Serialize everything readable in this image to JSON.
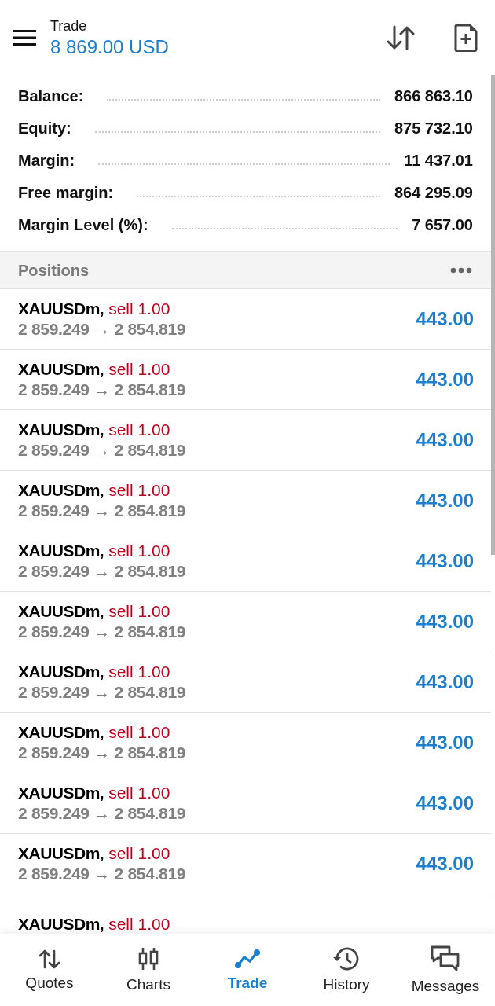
{
  "header": {
    "title": "Trade",
    "balance": "8 869.00 USD"
  },
  "summary": [
    {
      "label": "Balance:",
      "value": "866 863.10"
    },
    {
      "label": "Equity:",
      "value": "875 732.10"
    },
    {
      "label": "Margin:",
      "value": "11 437.01"
    },
    {
      "label": "Free margin:",
      "value": "864 295.09"
    },
    {
      "label": "Margin Level (%):",
      "value": "7 657.00"
    }
  ],
  "positions_header": {
    "title": "Positions"
  },
  "positions": [
    {
      "symbol": "XAUUSDm,",
      "side": "sell 1.00",
      "prices": "2 859.249 → 2 854.819",
      "profit": "443.00"
    },
    {
      "symbol": "XAUUSDm,",
      "side": "sell 1.00",
      "prices": "2 859.249 → 2 854.819",
      "profit": "443.00"
    },
    {
      "symbol": "XAUUSDm,",
      "side": "sell 1.00",
      "prices": "2 859.249 → 2 854.819",
      "profit": "443.00"
    },
    {
      "symbol": "XAUUSDm,",
      "side": "sell 1.00",
      "prices": "2 859.249 → 2 854.819",
      "profit": "443.00"
    },
    {
      "symbol": "XAUUSDm,",
      "side": "sell 1.00",
      "prices": "2 859.249 → 2 854.819",
      "profit": "443.00"
    },
    {
      "symbol": "XAUUSDm,",
      "side": "sell 1.00",
      "prices": "2 859.249 → 2 854.819",
      "profit": "443.00"
    },
    {
      "symbol": "XAUUSDm,",
      "side": "sell 1.00",
      "prices": "2 859.249 → 2 854.819",
      "profit": "443.00"
    },
    {
      "symbol": "XAUUSDm,",
      "side": "sell 1.00",
      "prices": "2 859.249 → 2 854.819",
      "profit": "443.00"
    },
    {
      "symbol": "XAUUSDm,",
      "side": "sell 1.00",
      "prices": "2 859.249 → 2 854.819",
      "profit": "443.00"
    },
    {
      "symbol": "XAUUSDm,",
      "side": "sell 1.00",
      "prices": "2 859.249 → 2 854.819",
      "profit": "443.00"
    },
    {
      "symbol": "XAUUSDm,",
      "side": "sell 1.00"
    }
  ],
  "nav": [
    {
      "label": "Quotes",
      "selected": false
    },
    {
      "label": "Charts",
      "selected": false
    },
    {
      "label": "Trade",
      "selected": true
    },
    {
      "label": "History",
      "selected": false
    },
    {
      "label": "Messages",
      "selected": false
    }
  ]
}
